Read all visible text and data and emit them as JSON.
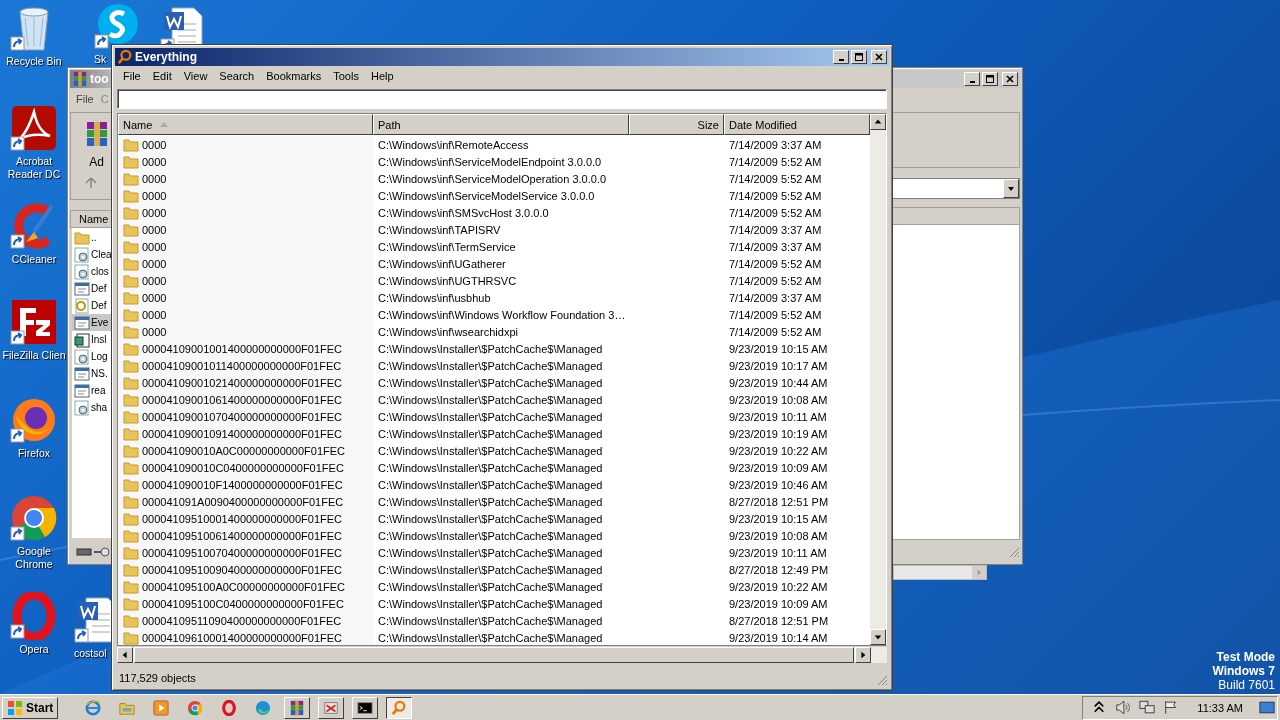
{
  "desktop": {
    "icons": [
      {
        "label": "Recycle Bin",
        "kind": "recycle"
      },
      {
        "label": "Acrobat Reader DC",
        "kind": "pdf"
      },
      {
        "label": "CCleaner",
        "kind": "ccleaner"
      },
      {
        "label": "FileZilla Clien",
        "kind": "filezilla"
      },
      {
        "label": "Firefox",
        "kind": "firefox"
      },
      {
        "label": "Google Chrome",
        "kind": "chrome"
      },
      {
        "label": "Opera",
        "kind": "opera"
      },
      {
        "label": "Sk",
        "kind": "skype"
      },
      {
        "kind": "word"
      },
      {
        "label": "costsol",
        "kind": "word"
      }
    ],
    "system_text": [
      "Test Mode",
      "Windows 7",
      "Build 7601"
    ]
  },
  "background_window": {
    "title": "too",
    "menu": [
      "File",
      "C"
    ],
    "toolbar_label": "Ad",
    "list_header": "Name",
    "items": [
      {
        "name": "..",
        "kind": "folder",
        "selected": false
      },
      {
        "name": "Clea",
        "kind": "config",
        "selected": false
      },
      {
        "name": "clos",
        "kind": "config",
        "selected": false
      },
      {
        "name": "Def",
        "kind": "app",
        "selected": false
      },
      {
        "name": "Def",
        "kind": "settings",
        "selected": false
      },
      {
        "name": "Eve",
        "kind": "app",
        "selected": true
      },
      {
        "name": "Insl",
        "kind": "installer",
        "selected": false
      },
      {
        "name": "Log",
        "kind": "config",
        "selected": false
      },
      {
        "name": "NS.",
        "kind": "app",
        "selected": false
      },
      {
        "name": "rea",
        "kind": "app",
        "selected": false
      },
      {
        "name": "sha",
        "kind": "config",
        "selected": false
      }
    ]
  },
  "window": {
    "title": "Everything",
    "menu": [
      "File",
      "Edit",
      "View",
      "Search",
      "Bookmarks",
      "Tools",
      "Help"
    ],
    "columns": [
      {
        "label": "Name",
        "sorted": true
      },
      {
        "label": "Path",
        "sorted": false
      },
      {
        "label": "Size",
        "sorted": false
      },
      {
        "label": "Date Modified",
        "sorted": false
      }
    ],
    "rows": [
      {
        "name": "0000",
        "path": "C:\\Windows\\inf\\RemoteAccess",
        "modified": "7/14/2009 3:37 AM"
      },
      {
        "name": "0000",
        "path": "C:\\Windows\\inf\\ServiceModelEndpoint 3.0.0.0",
        "modified": "7/14/2009 5:52 AM"
      },
      {
        "name": "0000",
        "path": "C:\\Windows\\inf\\ServiceModelOperation 3.0.0.0",
        "modified": "7/14/2009 5:52 AM"
      },
      {
        "name": "0000",
        "path": "C:\\Windows\\inf\\ServiceModelService 3.0.0.0",
        "modified": "7/14/2009 5:52 AM"
      },
      {
        "name": "0000",
        "path": "C:\\Windows\\inf\\SMSvcHost 3.0.0.0",
        "modified": "7/14/2009 5:52 AM"
      },
      {
        "name": "0000",
        "path": "C:\\Windows\\inf\\TAPISRV",
        "modified": "7/14/2009 3:37 AM"
      },
      {
        "name": "0000",
        "path": "C:\\Windows\\inf\\TermService",
        "modified": "7/14/2009 3:37 AM"
      },
      {
        "name": "0000",
        "path": "C:\\Windows\\inf\\UGatherer",
        "modified": "7/14/2009 5:52 AM"
      },
      {
        "name": "0000",
        "path": "C:\\Windows\\inf\\UGTHRSVC",
        "modified": "7/14/2009 5:52 AM"
      },
      {
        "name": "0000",
        "path": "C:\\Windows\\inf\\usbhub",
        "modified": "7/14/2009 3:37 AM"
      },
      {
        "name": "0000",
        "path": "C:\\Windows\\inf\\Windows Workflow Foundation 3…",
        "modified": "7/14/2009 5:52 AM"
      },
      {
        "name": "0000",
        "path": "C:\\Windows\\inf\\wsearchidxpi",
        "modified": "7/14/2009 5:52 AM"
      },
      {
        "name": "00004109001001400000000000F01FEC",
        "path": "C:\\Windows\\Installer\\$PatchCache$\\Managed",
        "modified": "9/23/2019 10:15 AM"
      },
      {
        "name": "00004109001011400000000000F01FEC",
        "path": "C:\\Windows\\Installer\\$PatchCache$\\Managed",
        "modified": "9/23/2019 10:17 AM"
      },
      {
        "name": "00004109001021400000000000F01FEC",
        "path": "C:\\Windows\\Installer\\$PatchCache$\\Managed",
        "modified": "9/23/2019 10:44 AM"
      },
      {
        "name": "00004109001061400000000000F01FEC",
        "path": "C:\\Windows\\Installer\\$PatchCache$\\Managed",
        "modified": "9/23/2019 10:08 AM"
      },
      {
        "name": "00004109001070400000000000F01FEC",
        "path": "C:\\Windows\\Installer\\$PatchCache$\\Managed",
        "modified": "9/23/2019 10:11 AM"
      },
      {
        "name": "00004109001091400000000000F01FEC",
        "path": "C:\\Windows\\Installer\\$PatchCache$\\Managed",
        "modified": "9/23/2019 10:19 AM"
      },
      {
        "name": "000041090010A0C00000000000F01FEC",
        "path": "C:\\Windows\\Installer\\$PatchCache$\\Managed",
        "modified": "9/23/2019 10:22 AM"
      },
      {
        "name": "000041090010C0400000000000F01FEC",
        "path": "C:\\Windows\\Installer\\$PatchCache$\\Managed",
        "modified": "9/23/2019 10:09 AM"
      },
      {
        "name": "000041090010F1400000000000F01FEC",
        "path": "C:\\Windows\\Installer\\$PatchCache$\\Managed",
        "modified": "9/23/2019 10:46 AM"
      },
      {
        "name": "000041091A0090400000000000F01FEC",
        "path": "C:\\Windows\\Installer\\$PatchCache$\\Managed",
        "modified": "8/27/2018 12:51 PM"
      },
      {
        "name": "00004109510001400000000000F01FEC",
        "path": "C:\\Windows\\Installer\\$PatchCache$\\Managed",
        "modified": "9/23/2019 10:15 AM"
      },
      {
        "name": "00004109510061400000000000F01FEC",
        "path": "C:\\Windows\\Installer\\$PatchCache$\\Managed",
        "modified": "9/23/2019 10:08 AM"
      },
      {
        "name": "00004109510070400000000000F01FEC",
        "path": "C:\\Windows\\Installer\\$PatchCache$\\Managed",
        "modified": "9/23/2019 10:11 AM"
      },
      {
        "name": "00004109510090400000000000F01FEC",
        "path": "C:\\Windows\\Installer\\$PatchCache$\\Managed",
        "modified": "8/27/2018 12:49 PM"
      },
      {
        "name": "000041095100A0C00000000000F01FEC",
        "path": "C:\\Windows\\Installer\\$PatchCache$\\Managed",
        "modified": "9/23/2019 10:22 AM"
      },
      {
        "name": "000041095100C0400000000000F01FEC",
        "path": "C:\\Windows\\Installer\\$PatchCache$\\Managed",
        "modified": "9/23/2019 10:09 AM"
      },
      {
        "name": "00004109511090400000000000F01FEC",
        "path": "C:\\Windows\\Installer\\$PatchCache$\\Managed",
        "modified": "8/27/2018 12:51 PM"
      },
      {
        "name": "00004109610001400000000000F01FEC",
        "path": "C:\\Windows\\Installer\\$PatchCache$\\Managed",
        "modified": "9/23/2019 10:14 AM"
      }
    ],
    "status_bar": "117,529 objects"
  },
  "taskbar": {
    "start": "Start",
    "apps": [
      {
        "kind": "ie",
        "running": false,
        "active": false
      },
      {
        "kind": "explorer",
        "running": false,
        "active": false
      },
      {
        "kind": "media",
        "running": false,
        "active": false
      },
      {
        "kind": "chrome",
        "running": false,
        "active": false
      },
      {
        "kind": "opera",
        "running": false,
        "active": false
      },
      {
        "kind": "edge",
        "running": false,
        "active": false
      },
      {
        "kind": "winrar",
        "running": true,
        "active": false
      },
      {
        "kind": "tool",
        "running": true,
        "active": false
      },
      {
        "kind": "cmd",
        "running": true,
        "active": false
      },
      {
        "kind": "everything",
        "running": true,
        "active": true
      }
    ],
    "clock": "11:33 AM"
  }
}
